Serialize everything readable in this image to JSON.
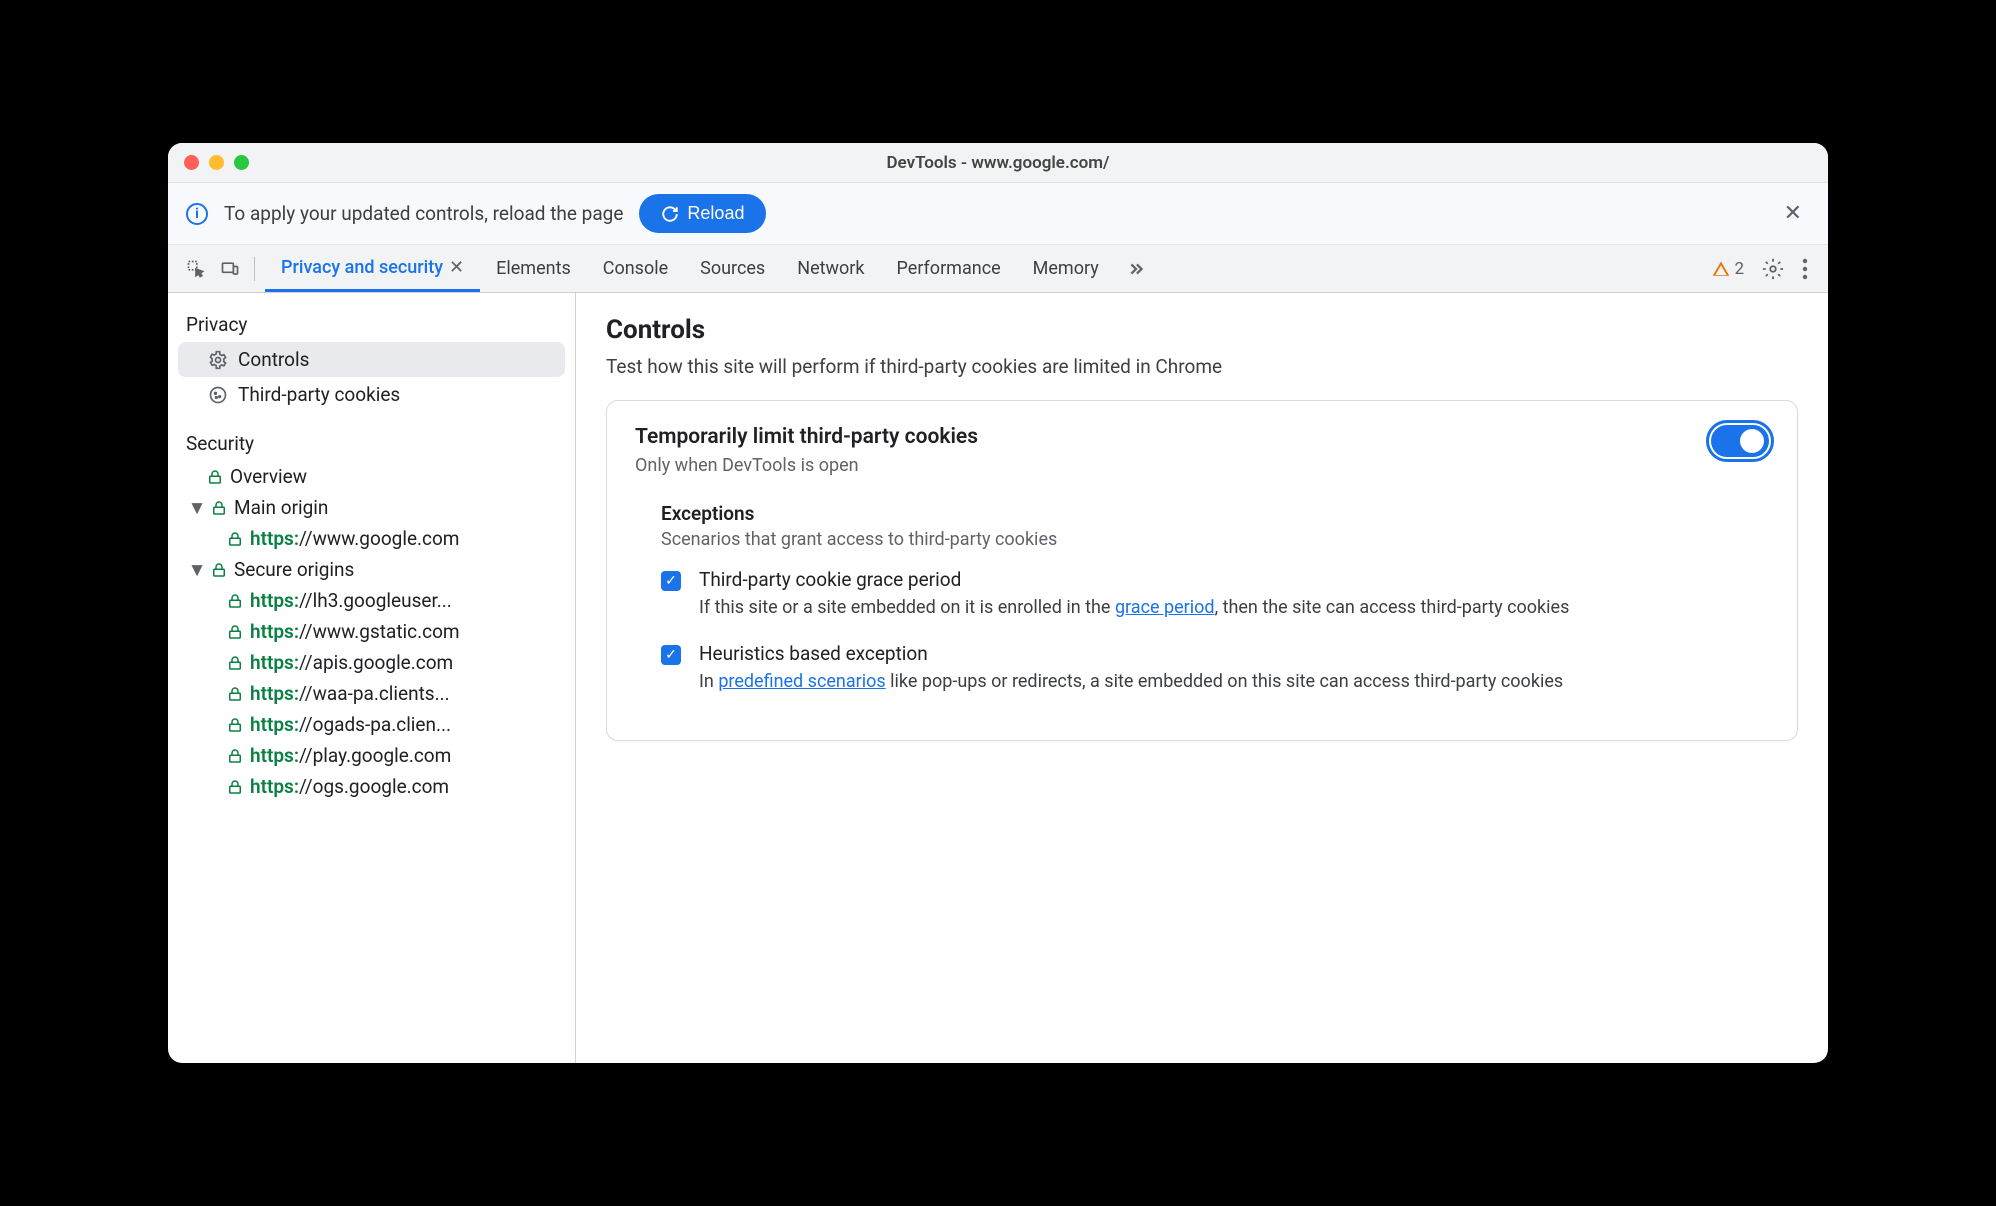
{
  "window": {
    "title": "DevTools - www.google.com/"
  },
  "infobar": {
    "text": "To apply your updated controls, reload the page",
    "reload_label": "Reload"
  },
  "tabs": {
    "active": "Privacy and security",
    "items": [
      "Elements",
      "Console",
      "Sources",
      "Network",
      "Performance",
      "Memory"
    ]
  },
  "warning_count": "2",
  "sidebar": {
    "privacy_title": "Privacy",
    "privacy_items": [
      {
        "icon": "gear",
        "label": "Controls",
        "selected": true
      },
      {
        "icon": "cookie",
        "label": "Third-party cookies",
        "selected": false
      }
    ],
    "security_title": "Security",
    "overview_label": "Overview",
    "main_origin_label": "Main origin",
    "main_origin_url": {
      "proto": "https:",
      "rest": "//www.google.com"
    },
    "secure_origins_label": "Secure origins",
    "secure_origins": [
      {
        "proto": "https:",
        "rest": "//lh3.googleuser..."
      },
      {
        "proto": "https:",
        "rest": "//www.gstatic.com"
      },
      {
        "proto": "https:",
        "rest": "//apis.google.com"
      },
      {
        "proto": "https:",
        "rest": "//waa-pa.clients..."
      },
      {
        "proto": "https:",
        "rest": "//ogads-pa.clien..."
      },
      {
        "proto": "https:",
        "rest": "//play.google.com"
      },
      {
        "proto": "https:",
        "rest": "//ogs.google.com"
      }
    ]
  },
  "main": {
    "heading": "Controls",
    "subtitle": "Test how this site will perform if third-party cookies are limited in Chrome",
    "card": {
      "title": "Temporarily limit third-party cookies",
      "sub": "Only when DevTools is open",
      "exceptions_title": "Exceptions",
      "exceptions_sub": "Scenarios that grant access to third-party cookies",
      "items": [
        {
          "label": "Third-party cookie grace period",
          "desc_pre": "If this site or a site embedded on it is enrolled in the ",
          "link": "grace period",
          "desc_post": ", then the site can access third-party cookies"
        },
        {
          "label": "Heuristics based exception",
          "desc_pre": "In ",
          "link": "predefined scenarios",
          "desc_post": " like pop-ups or redirects, a site embedded on this site can access third-party cookies"
        }
      ]
    }
  }
}
